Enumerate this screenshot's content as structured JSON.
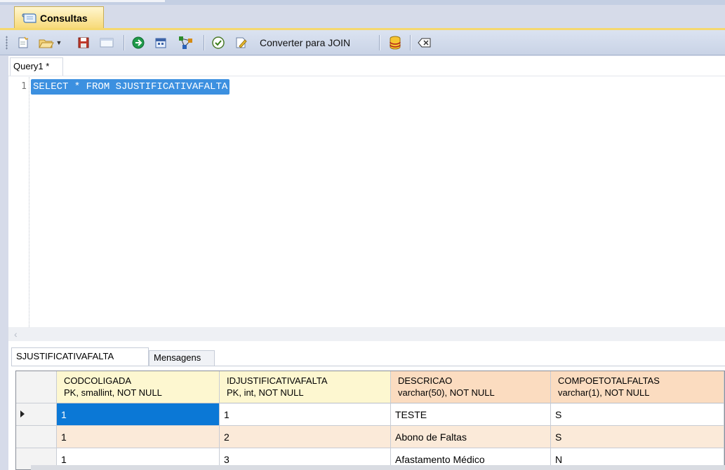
{
  "document_tab": {
    "label": "Consultas"
  },
  "toolbar": {
    "items": [
      {
        "name": "new-query-icon"
      },
      {
        "name": "open-query-icon"
      },
      {
        "name": "save-icon"
      },
      {
        "name": "window-icon"
      },
      {
        "name": "execute-icon"
      },
      {
        "name": "calendar-icon"
      },
      {
        "name": "diagram-icon"
      },
      {
        "name": "check-icon"
      },
      {
        "name": "edit-icon"
      },
      {
        "name": "database-icon"
      },
      {
        "name": "erase-icon"
      }
    ],
    "convert_label": "Converter para JOIN"
  },
  "query_tab": {
    "label": "Query1 *"
  },
  "editor": {
    "line_number": "1",
    "sql": "SELECT * FROM SJUSTIFICATIVAFALTA"
  },
  "results_tabs": [
    {
      "label": "SJUSTIFICATIVAFALTA",
      "active": true
    },
    {
      "label": "Mensagens",
      "active": false
    }
  ],
  "grid": {
    "columns": [
      {
        "name": "CODCOLIGADA",
        "type": "PK, smallint, NOT NULL",
        "color": "#fdf7d0"
      },
      {
        "name": "IDJUSTIFICATIVAFALTA",
        "type": "PK, int, NOT NULL",
        "color": "#fdf7d0"
      },
      {
        "name": "DESCRICAO",
        "type": "varchar(50), NOT NULL",
        "color": "#fbdcc0"
      },
      {
        "name": "COMPOETOTALFALTAS",
        "type": "varchar(1), NOT NULL",
        "color": "#fbdcc0"
      }
    ],
    "rows": [
      [
        "1",
        "1",
        "TESTE",
        "S"
      ],
      [
        "1",
        "2",
        "Abono de Faltas",
        "S"
      ],
      [
        "1",
        "3",
        "Afastamento Médico",
        "N"
      ]
    ],
    "selected_row": 0,
    "alt_row_color": "#fbead9",
    "selected_color": "#0b78d6"
  }
}
